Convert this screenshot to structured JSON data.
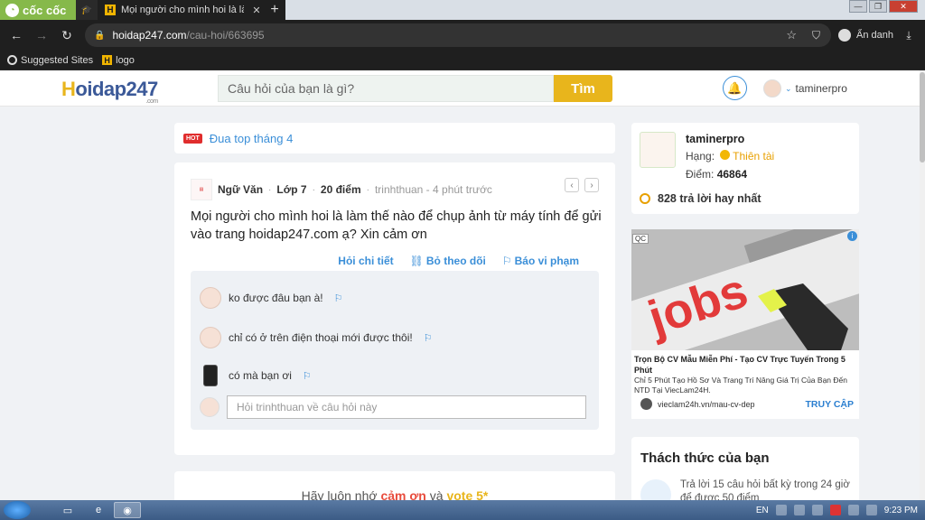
{
  "browser": {
    "brand_label": "cốc cốc",
    "active_tab_title": "Mọi người cho mình hoi là làm",
    "tab_close": "✕",
    "new_tab": "+",
    "url_host": "hoidap247.com",
    "url_path": "/cau-hoi/663695",
    "incognito_label": "Ẩn danh",
    "bookmarks": [
      {
        "label": "Suggested Sites",
        "icon": "globe-icon"
      },
      {
        "label": "logo",
        "icon": "hoidap-favicon"
      }
    ]
  },
  "site": {
    "logo_h": "H",
    "logo_rest": "oidap247",
    "logo_com": ".com",
    "search_placeholder": "Câu hỏi của bạn là gì?",
    "search_button": "Tìm",
    "header_username": "taminerpro"
  },
  "hot": {
    "badge": "HOT",
    "link": "Đua top tháng 4"
  },
  "question": {
    "subject": "Ngữ Văn",
    "grade": "Lớp 7",
    "points": "20 điểm",
    "asker_time": "trinhthuan - 4 phút trước",
    "text": "Mọi người cho mình hoi là làm thế nào để chụp ảnh từ máy tính để gửi vào trang hoidap247.com ạ? Xin cảm ơn",
    "actions": {
      "detail": "Hỏi chi tiết",
      "unfollow": "Bỏ theo dõi",
      "report": "Báo vi phạm"
    },
    "comments": [
      {
        "text": "ko được đâu bạn à!"
      },
      {
        "text": "chỉ có ở trên điện thoại mới được thôi!"
      },
      {
        "text": "có mà bạn ơi"
      }
    ],
    "comment_placeholder": "Hỏi trinhthuan về câu hỏi này"
  },
  "remind": {
    "prefix": "Hãy luôn nhớ",
    "thanks": "cảm ơn",
    "and": "và",
    "vote": "vote 5*"
  },
  "user_card": {
    "name": "taminerpro",
    "rank_label": "Hạng:",
    "rank_value": "Thiên tài",
    "points_label": "Điểm:",
    "points_value": "46864",
    "best_answers": "828 trả lời hay nhất"
  },
  "ad": {
    "badge": "QC",
    "image_text": "jobs",
    "title": "Trọn Bộ CV Mẫu Miễn Phí - Tạo CV Trực Tuyến Trong 5 Phút",
    "description": "Chỉ 5 Phút Tạo Hồ Sơ Và Trang Trí Nâng Giá Trị Của Bạn Đến NTD Tại ViecLam24H.",
    "domain": "vieclam24h.vn/mau-cv-dep",
    "cta": "TRUY CẬP"
  },
  "challenge": {
    "title": "Thách thức của bạn",
    "text": "Trả lời 15 câu hỏi  bất kỳ  trong 24 giờ để được 50 điểm"
  },
  "taskbar": {
    "lang": "EN",
    "time": "9:23 PM"
  },
  "colors": {
    "accent_blue": "#3b8fd8",
    "brand_yellow": "#e8b51c",
    "coccoc_green": "#86b94a",
    "hot_red": "#e02d2d"
  }
}
